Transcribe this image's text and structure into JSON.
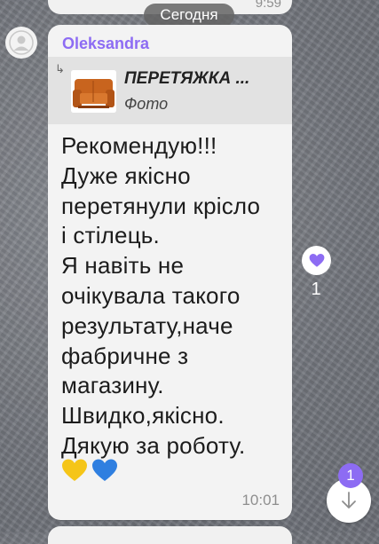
{
  "previous_message": {
    "time": "9:59"
  },
  "date_divider": "Сегодня",
  "message": {
    "sender": "Oleksandra",
    "reply": {
      "title": "ПЕРЕТЯЖКА ...",
      "subtitle": "Фото",
      "thumbnail_icon": "sofa-photo"
    },
    "lines": [
      "Рекомендую!!!",
      "Дуже якісно",
      "перетянули крісло",
      "і стілець.",
      "Я навіть не",
      "очікувала такого",
      "результату,наче",
      "фабричне з",
      "магазину.",
      "Швидко,якісно.",
      "Дякую за роботу."
    ],
    "emojis": [
      "yellow-heart",
      "blue-heart"
    ],
    "time": "10:01"
  },
  "reaction": {
    "icon": "purple-heart",
    "count": "1"
  },
  "scroll_button": {
    "icon": "arrow-down-icon",
    "badge_count": "1"
  },
  "colors": {
    "accent": "#8d6cf3",
    "bubble": "#f3f3f3",
    "reply_background": "#e2e2e2",
    "timestamp": "#8e8e8e",
    "yellow_heart": "#f5c518",
    "blue_heart": "#2f7fe0"
  }
}
